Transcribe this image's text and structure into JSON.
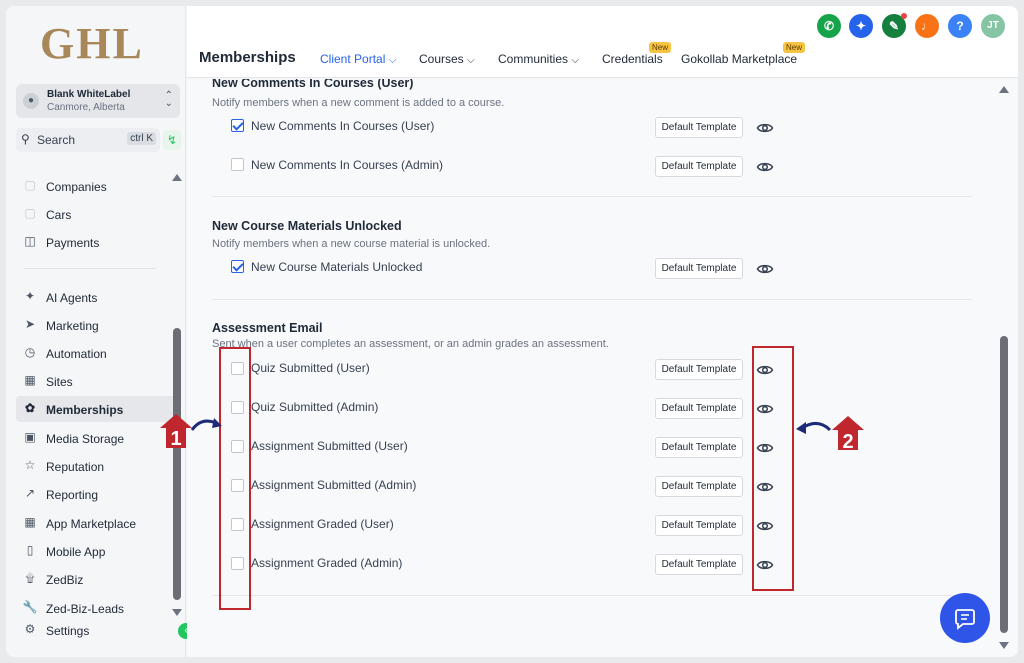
{
  "brand": {
    "logo_text": "GHL"
  },
  "account": {
    "name": "Blank WhiteLabel",
    "location": "Canmore, Alberta"
  },
  "search": {
    "label": "Search",
    "shortcut": "ctrl K"
  },
  "sidebar": {
    "items": [
      {
        "label": "Companies",
        "icon": "cube-icon"
      },
      {
        "label": "Cars",
        "icon": "cube-icon"
      },
      {
        "label": "Payments",
        "icon": "receipt-icon"
      },
      {
        "label": "AI Agents",
        "icon": "sparkle-icon"
      },
      {
        "label": "Marketing",
        "icon": "send-icon"
      },
      {
        "label": "Automation",
        "icon": "automation-icon"
      },
      {
        "label": "Sites",
        "icon": "sites-icon"
      },
      {
        "label": "Memberships",
        "icon": "badge-icon",
        "active": true
      },
      {
        "label": "Media Storage",
        "icon": "image-icon"
      },
      {
        "label": "Reputation",
        "icon": "star-icon"
      },
      {
        "label": "Reporting",
        "icon": "trend-icon"
      },
      {
        "label": "App Marketplace",
        "icon": "grid-icon"
      },
      {
        "label": "Mobile App",
        "icon": "phone-icon"
      },
      {
        "label": "ZedBiz",
        "icon": "spiral-icon"
      },
      {
        "label": "Zed-Biz-Leads",
        "icon": "wrench-icon"
      },
      {
        "label": "Settings",
        "icon": "gear-icon"
      }
    ]
  },
  "header": {
    "title": "Memberships",
    "tabs": [
      {
        "label": "Client Portal",
        "active": true,
        "dropdown": true
      },
      {
        "label": "Courses",
        "dropdown": true
      },
      {
        "label": "Communities",
        "dropdown": true
      },
      {
        "label": "Credentials",
        "badge": "New"
      },
      {
        "label": "Gokollab Marketplace",
        "badge": "New"
      }
    ],
    "user_initials": "JT",
    "colors": {
      "accent": "#2563eb",
      "phone": "#16a34a",
      "magic": "#2563eb",
      "megaphone": "#15803d",
      "bell": "#f97316",
      "help": "#3b82f6",
      "avatar": "#86c5a4"
    }
  },
  "content": {
    "sections": [
      {
        "title": "New Comments In Courses (User)",
        "description": "Notify members when a new comment is added to a course.",
        "rows": [
          {
            "label": "New Comments In Courses (User)",
            "checked": true,
            "template": "Default Template"
          },
          {
            "label": "New Comments In Courses (Admin)",
            "checked": false,
            "template": "Default Template"
          }
        ]
      },
      {
        "title": "New Course Materials Unlocked",
        "description": "Notify members when a new course material is unlocked.",
        "rows": [
          {
            "label": "New Course Materials Unlocked",
            "checked": true,
            "template": "Default Template"
          }
        ]
      },
      {
        "title": "Assessment Email",
        "description": "Sent when a user completes an assessment, or an admin grades an assessment.",
        "rows": [
          {
            "label": "Quiz Submitted (User)",
            "checked": false,
            "template": "Default Template"
          },
          {
            "label": "Quiz Submitted (Admin)",
            "checked": false,
            "template": "Default Template"
          },
          {
            "label": "Assignment Submitted (User)",
            "checked": false,
            "template": "Default Template"
          },
          {
            "label": "Assignment Submitted (Admin)",
            "checked": false,
            "template": "Default Template"
          },
          {
            "label": "Assignment Graded (User)",
            "checked": false,
            "template": "Default Template"
          },
          {
            "label": "Assignment Graded (Admin)",
            "checked": false,
            "template": "Default Template"
          }
        ]
      }
    ]
  },
  "annotations": [
    {
      "label": "1",
      "color": "#c0262d"
    },
    {
      "label": "2",
      "color": "#c0262d"
    }
  ]
}
